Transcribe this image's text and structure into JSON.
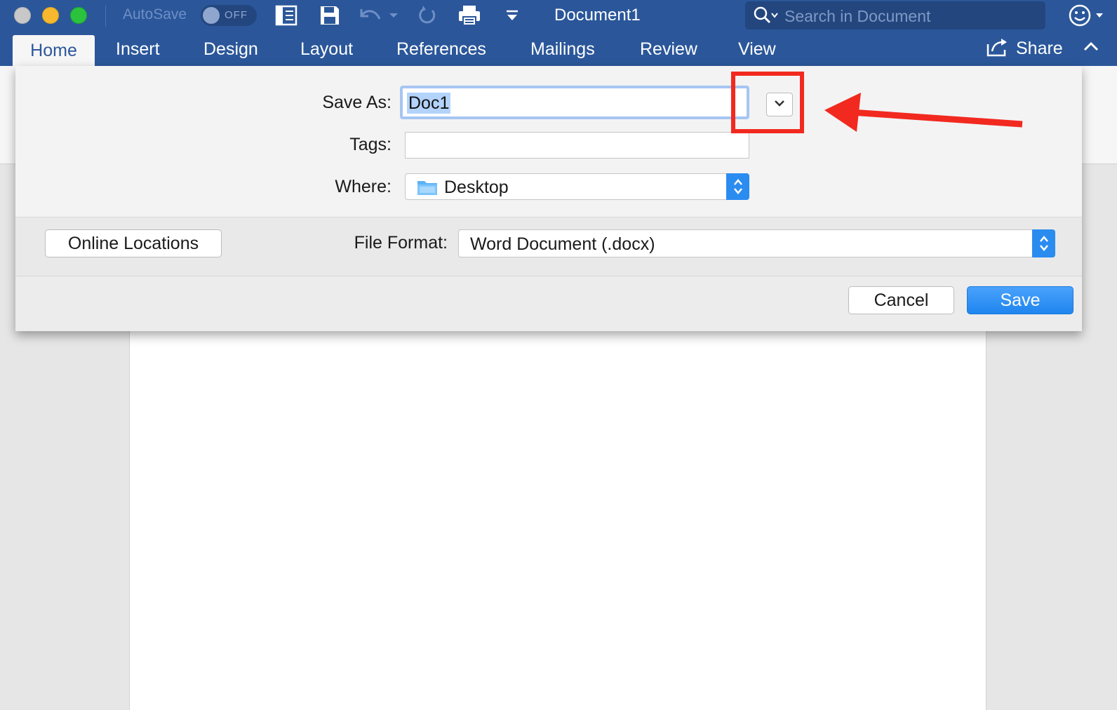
{
  "titlebar": {
    "autosave_label": "AutoSave",
    "autosave_state": "OFF",
    "document_title": "Document1",
    "search_placeholder": "Search in Document",
    "icons": [
      "sidebar-icon",
      "save-icon",
      "undo-icon",
      "undo-dropdown-icon",
      "redo-icon",
      "print-icon",
      "customize-toolbar-icon",
      "search-icon",
      "smiley-icon"
    ]
  },
  "ribbon": {
    "tabs": [
      {
        "label": "Home",
        "active": true
      },
      {
        "label": "Insert"
      },
      {
        "label": "Design"
      },
      {
        "label": "Layout"
      },
      {
        "label": "References"
      },
      {
        "label": "Mailings"
      },
      {
        "label": "Review"
      },
      {
        "label": "View"
      }
    ],
    "share_label": "Share"
  },
  "save_dialog": {
    "save_as_label": "Save As:",
    "save_as_value": "Doc1",
    "tags_label": "Tags:",
    "tags_value": "",
    "where_label": "Where:",
    "where_value": "Desktop",
    "online_locations_label": "Online Locations",
    "file_format_label": "File Format:",
    "file_format_value": "Word Document (.docx)",
    "cancel_label": "Cancel",
    "save_label": "Save"
  },
  "colors": {
    "title_bar": "#2b579a",
    "primary_button": "#2b8cf0",
    "annotation": "#f2291f",
    "selection": "#b3d3fb"
  }
}
